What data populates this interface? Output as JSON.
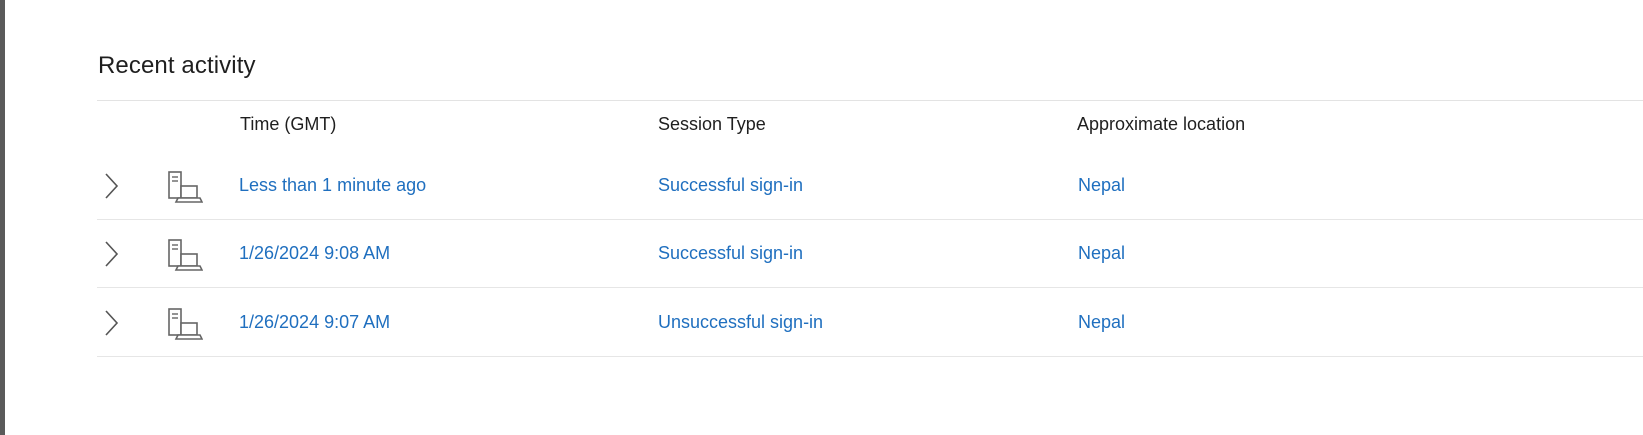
{
  "section": {
    "title": "Recent activity"
  },
  "table": {
    "headers": {
      "time": "Time (GMT)",
      "session_type": "Session Type",
      "location": "Approximate location"
    },
    "rows": [
      {
        "time": "Less than 1 minute ago",
        "session_type": "Successful sign-in",
        "location": "Nepal",
        "icon": "devices-icon"
      },
      {
        "time": "1/26/2024 9:08 AM",
        "session_type": "Successful sign-in",
        "location": "Nepal",
        "icon": "devices-icon"
      },
      {
        "time": "1/26/2024 9:07 AM",
        "session_type": "Unsuccessful sign-in",
        "location": "Nepal",
        "icon": "devices-icon"
      }
    ]
  },
  "colors": {
    "link": "#1f6fbf",
    "text": "#1f1f1f",
    "divider": "#e6e6e6",
    "left_edge": "#5a5a5a"
  }
}
